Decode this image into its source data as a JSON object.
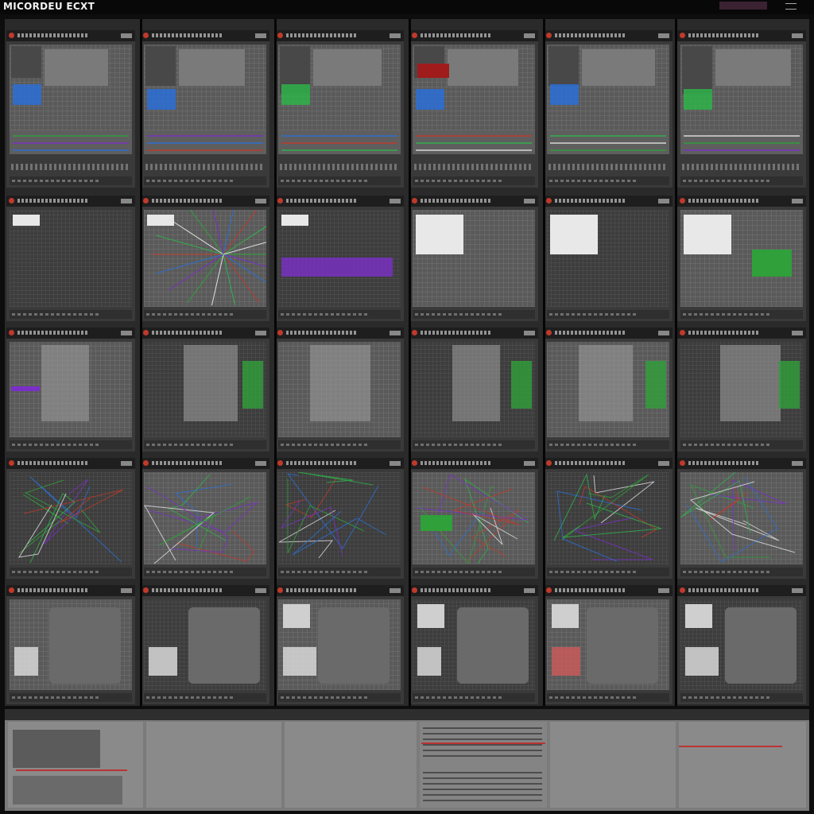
{
  "app": {
    "title": "MICORDEU ECXT",
    "accent_color": "#3a2232"
  },
  "grid": {
    "rows": 6,
    "cols": 6,
    "icons": [
      "close-dot-icon",
      "menu-icon"
    ],
    "accent_colors": [
      "#2fa03a",
      "#7a2fc8",
      "#2b6fd6",
      "#c0392b",
      "#2fb34a",
      "#e0e0e0"
    ]
  },
  "bottom_panel": {
    "divider_color": "#b33333"
  }
}
